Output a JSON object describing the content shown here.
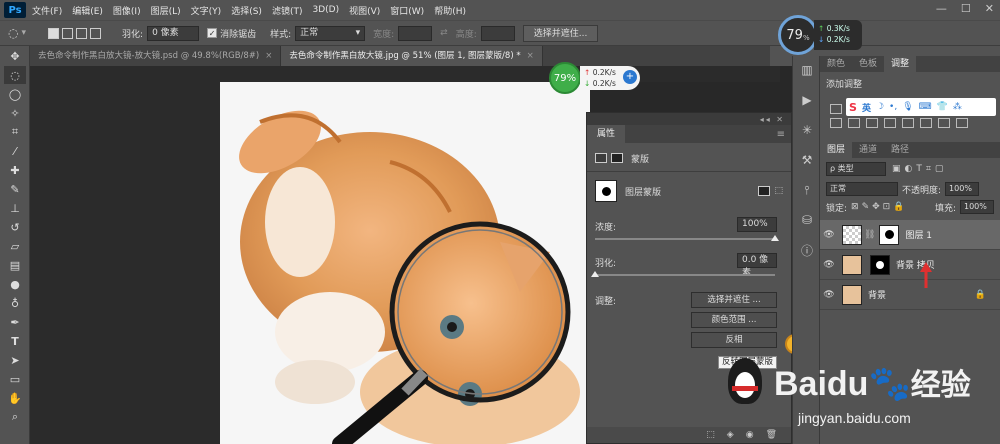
{
  "app": {
    "logo": "Ps"
  },
  "menu": [
    "文件(F)",
    "编辑(E)",
    "图像(I)",
    "图层(L)",
    "文字(Y)",
    "选择(S)",
    "滤镜(T)",
    "3D(D)",
    "视图(V)",
    "窗口(W)",
    "帮助(H)"
  ],
  "options": {
    "feather_label": "羽化:",
    "feather_value": "0 像素",
    "antialias_label": "消除锯齿",
    "style_label": "样式:",
    "style_value": "正常",
    "width_label": "宽度:",
    "height_label": "高度:",
    "select_mask_button": "选择并遮住..."
  },
  "doc_tabs": [
    {
      "label": "去色命令制作黑白放大镜-放大镜.psd @ 49.8%(RGB/8#)"
    },
    {
      "label": "去色命令制作黑白放大镜.jpg @ 51% (图层 1, 图层蒙版/8) *"
    }
  ],
  "net_widget_top": {
    "percent": "79",
    "unit": "%",
    "up": "0.3K/s",
    "down": "0.2K/s"
  },
  "net_widget_float": {
    "percent": "79%",
    "up": "0.2K/s",
    "down": "0.2K/s",
    "plus": "+"
  },
  "properties": {
    "tab": "属性",
    "section": "蒙版",
    "mask_label": "图层蒙版",
    "density_label": "浓度:",
    "density_value": "100%",
    "density_fraction": 1.0,
    "feather_label": "羽化:",
    "feather_value": "0.0 像素",
    "feather_fraction": 0.0,
    "adjust_label": "调整:",
    "btn_select_mask": "选择并遮住 ...",
    "btn_color_range": "颜色范围 ...",
    "btn_invert": "反相",
    "tooltip": "反转图层蒙版"
  },
  "right_panel": {
    "tabs_top": [
      "颜色",
      "色板",
      "调整"
    ],
    "add_adjust": "添加调整",
    "ime": [
      "S",
      "英"
    ],
    "tabs_layers": [
      "图层",
      "通道",
      "路径"
    ],
    "kind": "ρ 类型",
    "blend": "正常",
    "opacity_label": "不透明度:",
    "opacity_value": "100%",
    "lock_label": "锁定:",
    "fill_label": "填充:",
    "fill_value": "100%",
    "layers": [
      {
        "name": "图层 1"
      },
      {
        "name": "背景 拷贝"
      },
      {
        "name": "背景"
      }
    ]
  },
  "watermark": {
    "brand": "Baidu",
    "brand_cn": "经验",
    "url": "jingyan.baidu.com"
  },
  "colors": {
    "accent_green": "#3fae49",
    "blue": "#2b78d0",
    "arrow_red": "#e03030"
  }
}
